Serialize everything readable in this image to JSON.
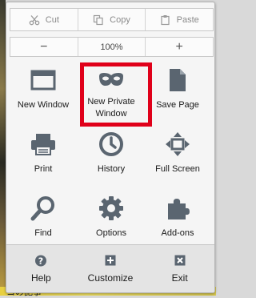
{
  "edit_row": {
    "cut_label": "Cut",
    "copy_label": "Copy",
    "paste_label": "Paste"
  },
  "zoom_row": {
    "minus_label": "−",
    "zoom_level": "100%",
    "plus_label": "+"
  },
  "grid": {
    "items": [
      {
        "label": "New Window",
        "icon": "window-icon"
      },
      {
        "label": "New Private Window",
        "icon": "private-mask-icon"
      },
      {
        "label": "Save Page",
        "icon": "page-icon"
      },
      {
        "label": "Print",
        "icon": "printer-icon"
      },
      {
        "label": "History",
        "icon": "clock-icon"
      },
      {
        "label": "Full Screen",
        "icon": "fullscreen-icon"
      },
      {
        "label": "Find",
        "icon": "magnifier-icon"
      },
      {
        "label": "Options",
        "icon": "gear-icon"
      },
      {
        "label": "Add-ons",
        "icon": "puzzle-icon"
      }
    ]
  },
  "footer": {
    "help_label": "Help",
    "customize_label": "Customize",
    "exit_label": "Exit"
  },
  "background": {
    "bottom_text": "コの記事"
  },
  "colors": {
    "highlight": "#e0001a",
    "icon": "#5a6570"
  }
}
